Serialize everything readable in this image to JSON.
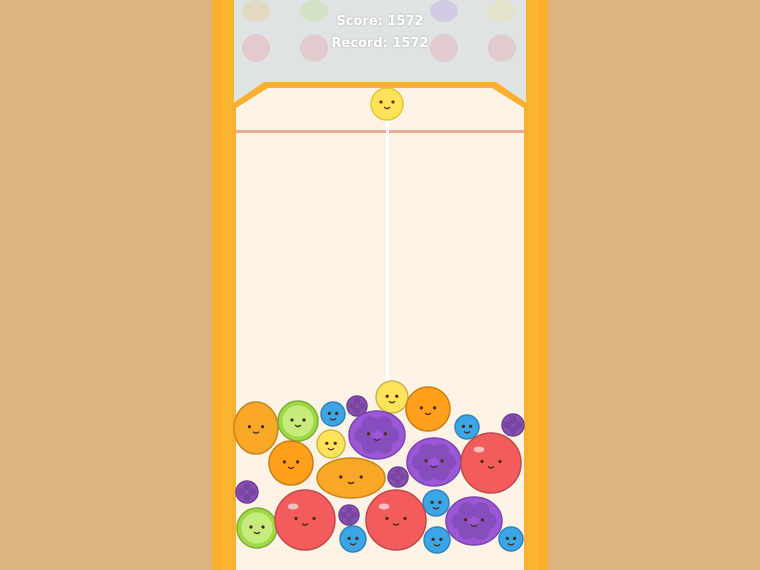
{
  "hud": {
    "score_label": "Score: 1572",
    "record_label": "Record: 1572"
  },
  "colors": {
    "background": "#dcb583",
    "frame": "#fbb02d",
    "board": "#fdf3e5",
    "danger_line": "#f0a898",
    "drop_guide": "#ffffff"
  },
  "current_fruit": {
    "type": "lemon",
    "color": "#fce35a"
  },
  "fruit_pile": [
    {
      "type": "mango",
      "color": "#f9a825"
    },
    {
      "type": "lime",
      "color": "#9ed844"
    },
    {
      "type": "blueberry",
      "color": "#3ba5e6"
    },
    {
      "type": "blackberry",
      "color": "#8a4fb5"
    },
    {
      "type": "lemon",
      "color": "#fce35a"
    },
    {
      "type": "lemon",
      "color": "#fce35a"
    },
    {
      "type": "grape",
      "color": "#9b57d6"
    },
    {
      "type": "orange",
      "color": "#ff9f1c"
    },
    {
      "type": "blueberry",
      "color": "#3ba5e6"
    },
    {
      "type": "blackberry",
      "color": "#8a4fb5"
    },
    {
      "type": "orange",
      "color": "#ff9f1c"
    },
    {
      "type": "mango",
      "color": "#f9a825"
    },
    {
      "type": "grape",
      "color": "#9b57d6"
    },
    {
      "type": "apple",
      "color": "#f25c5c"
    },
    {
      "type": "blackberry",
      "color": "#8a4fb5"
    },
    {
      "type": "blackberry",
      "color": "#8a4fb5"
    },
    {
      "type": "blueberry",
      "color": "#3ba5e6"
    },
    {
      "type": "lime",
      "color": "#9ed844"
    },
    {
      "type": "apple",
      "color": "#f25c5c"
    },
    {
      "type": "blackberry",
      "color": "#8a4fb5"
    },
    {
      "type": "blueberry",
      "color": "#3ba5e6"
    },
    {
      "type": "apple",
      "color": "#f25c5c"
    },
    {
      "type": "blueberry",
      "color": "#3ba5e6"
    },
    {
      "type": "grape",
      "color": "#9b57d6"
    },
    {
      "type": "blueberry",
      "color": "#3ba5e6"
    }
  ]
}
